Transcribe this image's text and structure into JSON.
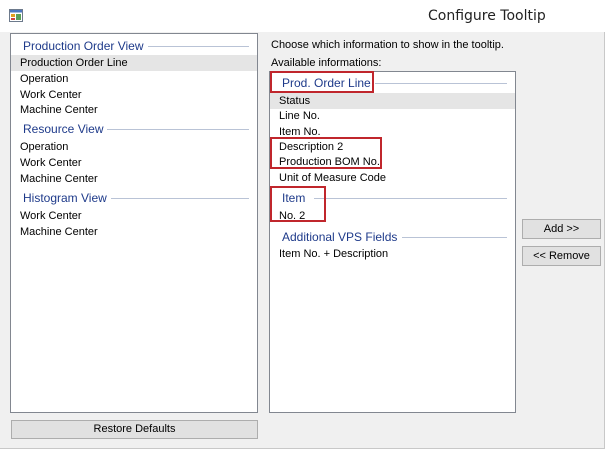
{
  "window": {
    "title": "Configure Tooltip"
  },
  "left_panel": {
    "groups": [
      {
        "label": "Production Order View",
        "items": [
          "Production Order Line",
          "Operation",
          "Work Center",
          "Machine Center"
        ]
      },
      {
        "label": "Resource View",
        "items": [
          "Operation",
          "Work Center",
          "Machine Center"
        ]
      },
      {
        "label": "Histogram View",
        "items": [
          "Work Center",
          "Machine Center"
        ]
      }
    ],
    "selected_item": "Production Order Line"
  },
  "right_panel": {
    "instruction": "Choose which information to show in the tooltip.",
    "available_label": "Available informations:",
    "groups": [
      {
        "label": "Prod. Order Line",
        "items": [
          "Status",
          "Line No.",
          "Item No.",
          "Description 2",
          "Production BOM No.",
          "Unit of Measure Code"
        ]
      },
      {
        "label": "Item",
        "items": [
          "No. 2"
        ]
      },
      {
        "label": "Additional VPS Fields",
        "items": [
          "Item No. + Description"
        ]
      }
    ],
    "selected_item": "Status"
  },
  "buttons": {
    "add": "Add >>",
    "remove": "<< Remove",
    "restore": "Restore Defaults"
  },
  "colors": {
    "group_header": "#1e3a8a",
    "callout": "#c0262c"
  }
}
